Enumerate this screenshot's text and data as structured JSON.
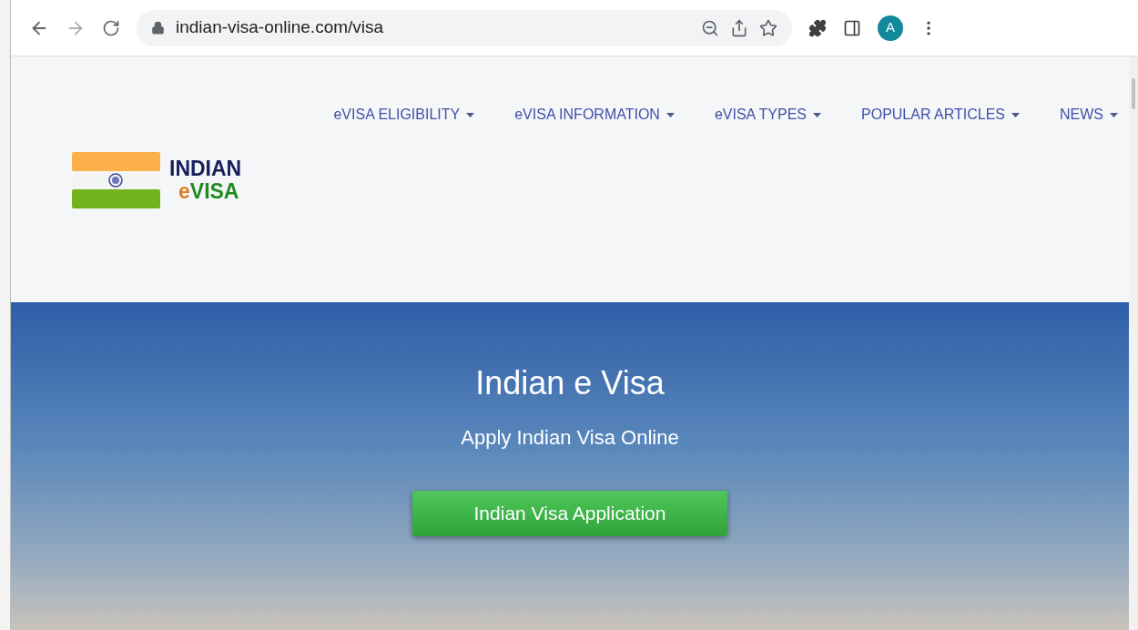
{
  "browser": {
    "url": "indian-visa-online.com/visa",
    "profile_initial": "A"
  },
  "nav": {
    "items": [
      {
        "label": "eVISA ELIGIBILITY"
      },
      {
        "label": "eVISA INFORMATION"
      },
      {
        "label": "eVISA TYPES"
      },
      {
        "label": "POPULAR ARTICLES"
      },
      {
        "label": "NEWS"
      }
    ]
  },
  "logo": {
    "line1": "INDIAN",
    "line2_accent": "e",
    "line2_rest": "VISA"
  },
  "hero": {
    "title": "Indian e Visa",
    "subtitle": "Apply Indian Visa Online",
    "button": "Indian Visa Application"
  }
}
